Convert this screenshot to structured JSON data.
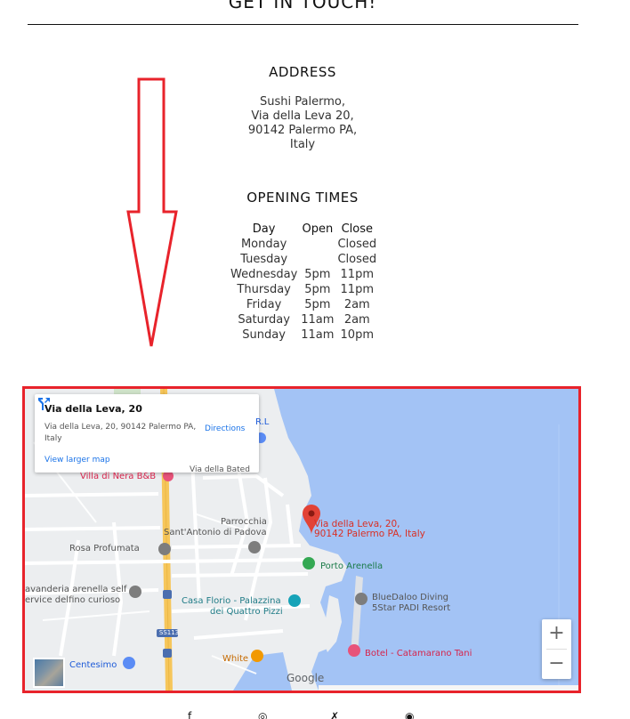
{
  "page": {
    "heading": "GET IN TOUCH!"
  },
  "address": {
    "title": "ADDRESS",
    "lines": [
      "Sushi Palermo,",
      "Via della Leva 20,",
      "90142 Palermo PA,",
      "Italy"
    ]
  },
  "opening": {
    "title": "OPENING TIMES",
    "headers": [
      "Day",
      "Open",
      "Close"
    ],
    "rows": [
      [
        "Monday",
        "",
        "Closed"
      ],
      [
        "Tuesday",
        "",
        "Closed"
      ],
      [
        "Wednesday",
        "5pm",
        "11pm"
      ],
      [
        "Thursday",
        "5pm",
        "11pm"
      ],
      [
        "Friday",
        "5pm",
        "2am"
      ],
      [
        "Saturday",
        "11am",
        "2am"
      ],
      [
        "Sunday",
        "11am",
        "10pm"
      ]
    ]
  },
  "map": {
    "card_title": "Via della Leva, 20",
    "card_address": "Via della Leva, 20, 90142 Palermo PA, Italy",
    "directions": "Directions",
    "view_larger": "View larger map",
    "pin_label_1": "Via della Leva, 20,",
    "pin_label_2": "90142 Palermo PA, Italy",
    "labels": {
      "rl": "R.L",
      "via_della_bated": "Via della Bated",
      "villa_di_nera": "Villa di Nera B&B",
      "parrocchia_1": "Parrocchia",
      "parrocchia_2": "Sant'Antonio di Padova",
      "rosa_profumata": "Rosa Profumata",
      "porto_arenella": "Porto Arenella",
      "lavanderia_1": "avanderia arenella self",
      "lavanderia_2": "ervice delfino curioso",
      "bluedaloo_1": "BlueDaloo Diving",
      "bluedaloo_2": "5Star PADI Resort",
      "casa_florio_1": "Casa Florio - Palazzina",
      "casa_florio_2": "dei Quattro Pizzi",
      "ss113": "SS113",
      "botel": "Botel - Catamarano Tani",
      "centesimo": "Centesimo",
      "white": "White",
      "google": "Google"
    },
    "zoom_in": "+",
    "zoom_out": "−",
    "colors": {
      "sea": "#a3c3f5",
      "land": "#eceef0",
      "road_major": "#f6c65b",
      "pin": "#e24236"
    }
  },
  "social": {
    "icons": [
      "facebook-icon",
      "instagram-icon",
      "twitter-icon",
      "tripadvisor-icon"
    ],
    "glyphs": [
      "f",
      "◎",
      "✗",
      "◉"
    ]
  }
}
